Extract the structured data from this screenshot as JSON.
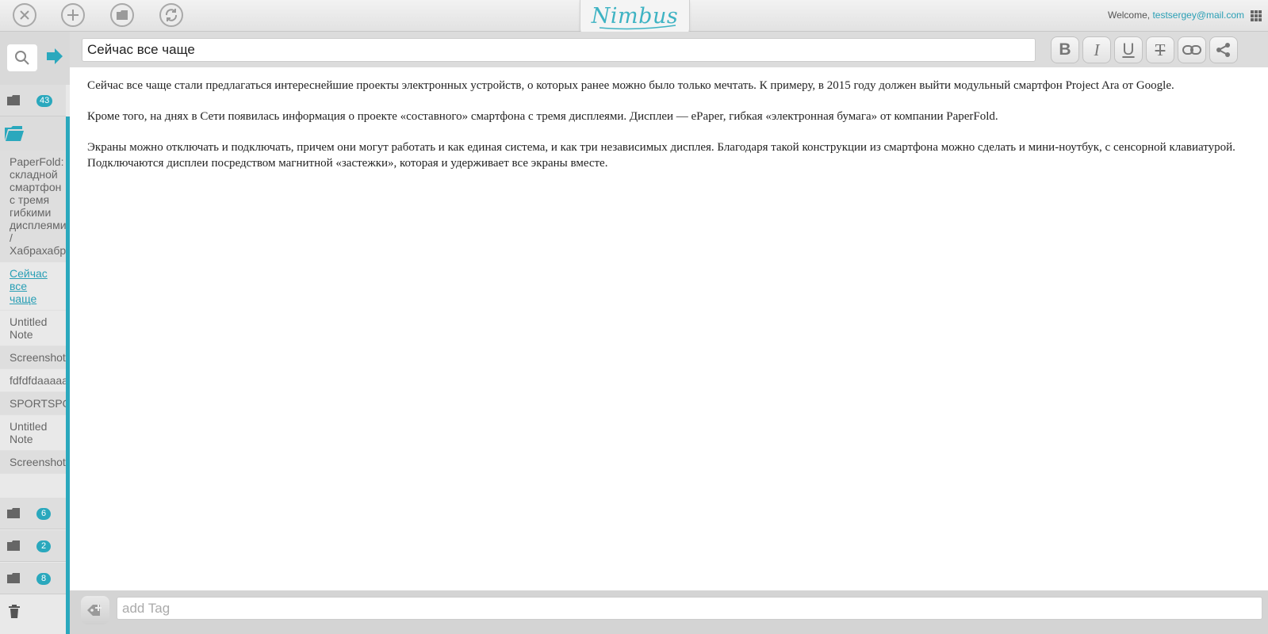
{
  "header": {
    "logo": "Nimbus",
    "welcome_label": "Welcome,",
    "user_email": "testsergey@mail.com"
  },
  "toolbar": {
    "icons": [
      "close-icon",
      "add-icon",
      "folder-icon",
      "sync-icon"
    ]
  },
  "sidebar": {
    "folders_top": [
      {
        "count": "43"
      }
    ],
    "notes": [
      {
        "label": "PaperFold:\nскладной\nсмартфон\nс тремя\nгибкими\nдисплеями\n/\nХабрахабр",
        "style": "alt"
      },
      {
        "label": "Сейчас\nвсе\nчаще",
        "style": "active"
      },
      {
        "label": "Untitled\nNote",
        "style": ""
      },
      {
        "label": "Screenshot",
        "style": "alt"
      },
      {
        "label": "fdfdfdaaaaa",
        "style": ""
      },
      {
        "label": "SPORTSPO",
        "style": "alt"
      },
      {
        "label": "Untitled\nNote",
        "style": ""
      },
      {
        "label": "Screenshot",
        "style": "alt"
      }
    ],
    "folders_bottom": [
      {
        "count": "6"
      },
      {
        "count": "2"
      },
      {
        "count": "8"
      }
    ]
  },
  "editor": {
    "title": "Сейчас все чаще",
    "format_buttons": {
      "bold": "B",
      "italic": "I",
      "underline": "U",
      "strike": "T"
    },
    "paragraphs": [
      "Сейчас все чаще стали предлагаться интереснейшие проекты электронных устройств, о которых ранее можно было только мечтать. К примеру, в 2015 году должен выйти модульный смартфон Project Ara от Google.",
      "Кроме того, на днях в Сети появилась информация о проекте «составного» смартфона с тремя дисплеями. Дисплеи — ePaper, гибкая «электронная бумага» от компании PaperFold.",
      "Экраны можно отключать и подключать, причем они могут работать и как единая система, и как три независимых дисплея. Благодаря такой конструкции из смартфона можно сделать и мини-ноутбук, с сенсорной клавиатурой. Подключаются дисплеи посредством магнитной «застежки», которая и удерживает все экраны вместе."
    ]
  },
  "tags": {
    "placeholder": "add Tag"
  },
  "colors": {
    "accent": "#2aa8bd",
    "logo": "#3eb3c3"
  }
}
